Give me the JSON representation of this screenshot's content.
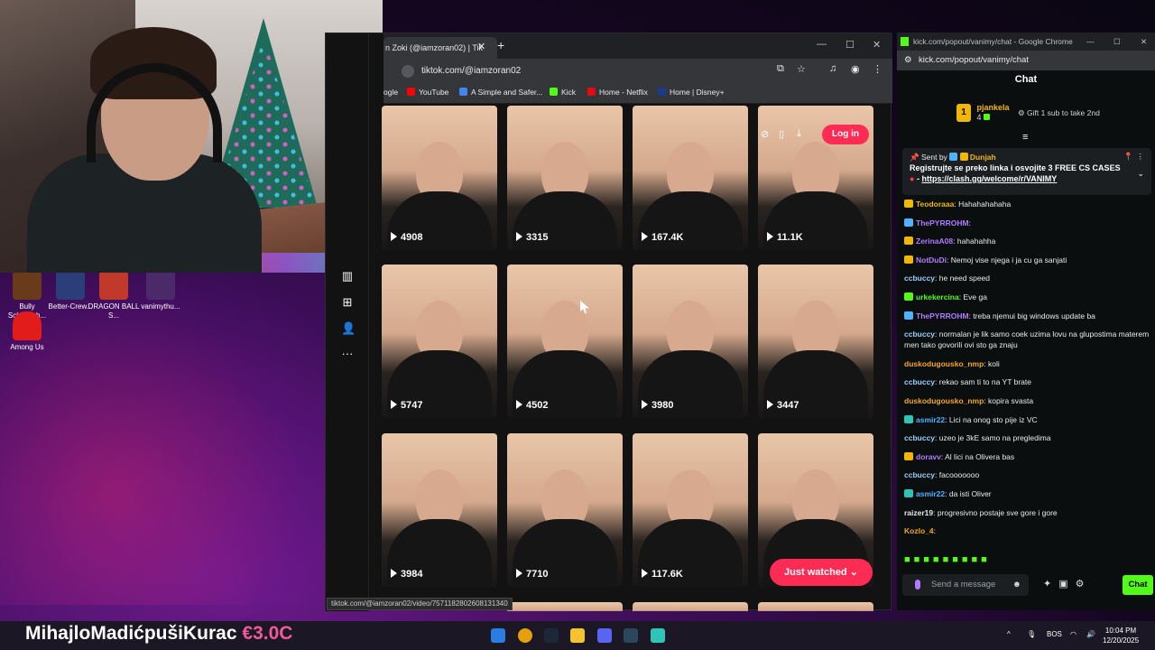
{
  "desktop": {
    "icons": [
      {
        "label": "Bully Scholarsh..."
      },
      {
        "label": "Better-Crew..."
      },
      {
        "label": "DRAGON BALL S..."
      },
      {
        "label": "vanimythu..."
      },
      {
        "label": "Among Us"
      }
    ]
  },
  "tiktok": {
    "tab_title": "n Zoki (@iamzoran02) | Tik",
    "url": "tiktok.com/@iamzoran02",
    "bookmarks": [
      "ogle",
      "YouTube",
      "A Simple and Safer...",
      "Kick",
      "Home - Netflix",
      "Home | Disney+"
    ],
    "login_label": "Log in",
    "just_watched_label": "Just watched",
    "videos": [
      {
        "views": "4908"
      },
      {
        "views": "3315"
      },
      {
        "views": "167.4K"
      },
      {
        "views": "11.1K"
      },
      {
        "views": "5747"
      },
      {
        "views": "4502"
      },
      {
        "views": "3980"
      },
      {
        "views": "3447"
      },
      {
        "views": "3984"
      },
      {
        "views": "7710"
      },
      {
        "views": "117.6K"
      },
      {
        "views": ""
      }
    ],
    "status_url": "tiktok.com/@iamzoran02/video/7571182802608131340"
  },
  "kick": {
    "window_title": "kick.com/popout/vanimy/chat - Google Chrome",
    "url": "kick.com/popout/vanimy/chat",
    "header": "Chat",
    "top_gifter": {
      "rank": "1",
      "name": "pjankela",
      "count": "4"
    },
    "gift_hint": "Gift 1 sub to take 2nd",
    "pinned": {
      "sent_by_prefix": "Sent by",
      "sender": "Dunjah",
      "message": "Registrujte se preko linka i osvojite 3 FREE CS CASES",
      "link_prefix": "- ",
      "link": "https://clash.gg/welcome/r/VANIMY"
    },
    "messages": [
      {
        "user": "Teodoraaa",
        "text": "Hahahahahaha",
        "color": "#f2b705",
        "badge": "#f2b705"
      },
      {
        "user": "ThePYRROHM",
        "text": "",
        "color": "#b07cff",
        "badge": "#4fb3ff"
      },
      {
        "user": "ZerinaA08",
        "text": "hahahahha",
        "color": "#b07cff",
        "badge": "#f2b705"
      },
      {
        "user": "NotDuDi",
        "text": "Nemoj vise njega i ja cu ga sanjati",
        "color": "#b07cff",
        "badge": "#f2b705"
      },
      {
        "user": "ccbuccy",
        "text": "he need speed",
        "color": "#9ad0ff",
        "badge": ""
      },
      {
        "user": "urkekercina",
        "text": "Eve ga",
        "color": "#53fc18",
        "badge": "#53fc18"
      },
      {
        "user": "ThePYRROHM",
        "text": "treba njemui big windows update ba",
        "color": "#b07cff",
        "badge": "#4fb3ff"
      },
      {
        "user": "ccbuccy",
        "text": "normalan je lik samo coek uzima lovu na glupostima materem men tako govorili ovi sto ga znaju",
        "color": "#9ad0ff",
        "badge": ""
      },
      {
        "user": "duskodugousko_nmp",
        "text": "koli",
        "color": "#f5a623",
        "badge": ""
      },
      {
        "user": "ccbuccy",
        "text": "rekao sam ti to na YT brate",
        "color": "#9ad0ff",
        "badge": ""
      },
      {
        "user": "duskodugousko_nmp",
        "text": "kopira svasta",
        "color": "#f5a623",
        "badge": ""
      },
      {
        "user": "asmir22",
        "text": "Lici na onog sto pije iz VC",
        "color": "#4fb3ff",
        "badge": "#2ec4b6"
      },
      {
        "user": "ccbuccy",
        "text": "uzeo je 3kE samo na pregledima",
        "color": "#9ad0ff",
        "badge": ""
      },
      {
        "user": "doravv",
        "text": "Al lici na Olivera bas",
        "color": "#b07cff",
        "badge": "#f2b705"
      },
      {
        "user": "ccbuccy",
        "text": "facooooooo",
        "color": "#9ad0ff",
        "badge": ""
      },
      {
        "user": "asmir22",
        "text": "da isti Oliver",
        "color": "#4fb3ff",
        "badge": "#2ec4b6"
      },
      {
        "user": "raizer19",
        "text": "progresivno postaje sve gore i gore",
        "color": "#e8eaed",
        "badge": ""
      },
      {
        "user": "Kozlo_4",
        "text": "",
        "color": "#f5a623",
        "badge": ""
      }
    ],
    "input_placeholder": "Send a message",
    "send_label": "Chat"
  },
  "stream_overlay": {
    "donor": "MihajloMadićpušiKurac",
    "amount": "€3.0C"
  },
  "taskbar": {
    "lang": "BOS",
    "time": "10:04 PM",
    "date": "12/20/2025"
  }
}
